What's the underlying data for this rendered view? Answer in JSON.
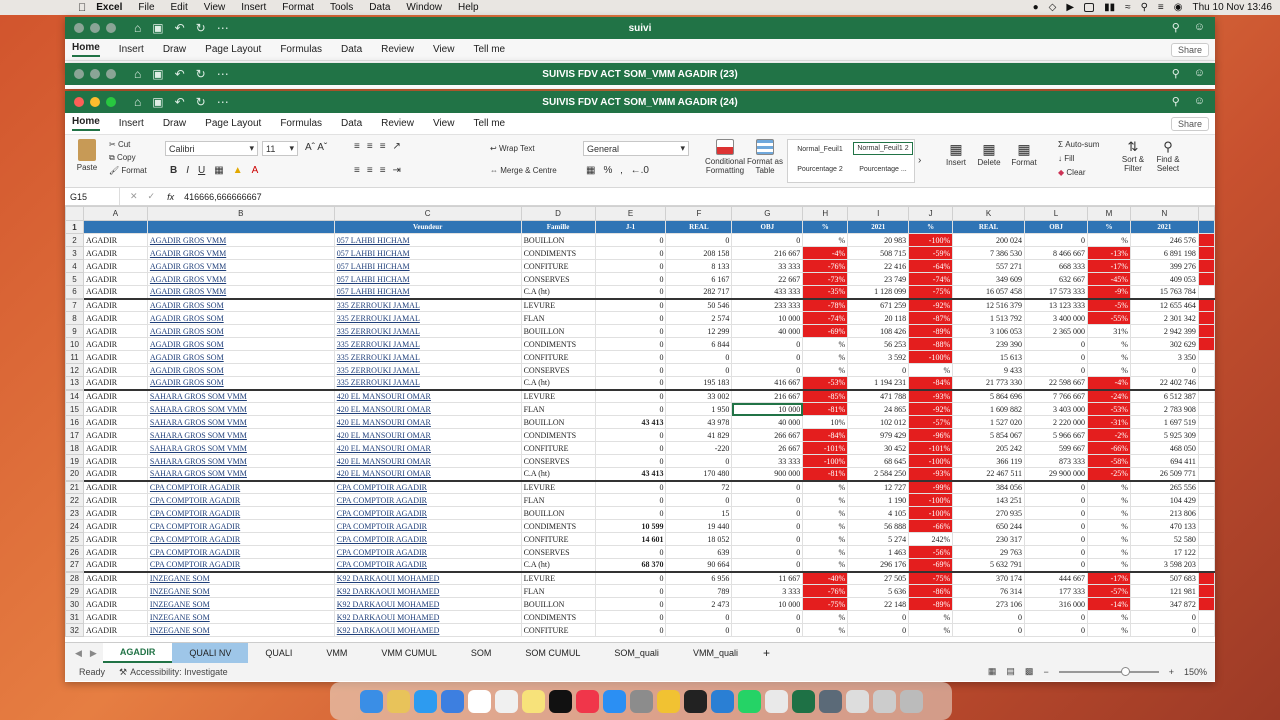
{
  "menubar": {
    "app": "Excel",
    "items": [
      "File",
      "Edit",
      "View",
      "Insert",
      "Format",
      "Tools",
      "Data",
      "Window",
      "Help"
    ],
    "datetime": "Thu 10 Nov  13:46"
  },
  "windows": {
    "w1_title": "suivi",
    "w2_title": "SUIVIS FDV ACT SOM_VMM AGADIR (23)",
    "w3_title": "SUIVIS FDV ACT SOM_VMM AGADIR (24)"
  },
  "ribbon_tabs": [
    "Home",
    "Insert",
    "Draw",
    "Page Layout",
    "Formulas",
    "Data",
    "Review",
    "View",
    "Tell me"
  ],
  "share": "Share",
  "ribbon": {
    "paste": "Paste",
    "cut": "Cut",
    "copy": "Copy",
    "format": "Format",
    "font": "Calibri",
    "size": "11",
    "wrap": "Wrap Text",
    "merge": "Merge & Centre",
    "numfmt": "General",
    "cond": "Conditional Formatting",
    "fmt_table": "Format as Table",
    "style1": "Normal_Feuil1",
    "style2": "Normal_Feuil1 2",
    "style3": "Pourcentage 2",
    "style4": "Pourcentage ...",
    "insert": "Insert",
    "delete": "Delete",
    "format2": "Format",
    "autosum": "Auto-sum",
    "fill": "Fill",
    "clear": "Clear",
    "sort": "Sort & Filter",
    "find": "Find & Select"
  },
  "formula": {
    "cell": "G15",
    "fx": "fx",
    "value": "416666,666666667"
  },
  "columns": [
    "A",
    "B",
    "C",
    "D",
    "E",
    "F",
    "G",
    "H",
    "I",
    "J",
    "K",
    "L",
    "M",
    "N"
  ],
  "header_row": [
    "",
    "",
    "Veundeur",
    "Famille",
    "J-1",
    "REAL",
    "OBJ",
    "%",
    "2021",
    "%",
    "REAL",
    "OBJ",
    "%",
    "2021"
  ],
  "rows": [
    [
      "2",
      "AGADIR",
      "AGADIR GROS VMM",
      "057 LAHBI HICHAM",
      "BOUILLON",
      "0",
      "0",
      "0",
      "%",
      "20 983",
      "-100%",
      "200 024",
      "0",
      "%",
      "246 576"
    ],
    [
      "3",
      "AGADIR",
      "AGADIR GROS VMM",
      "057 LAHBI HICHAM",
      "CONDIMENTS",
      "0",
      "208 158",
      "216 667",
      "-4%",
      "508 715",
      "-59%",
      "7 386 530",
      "8 466 667",
      "-13%",
      "6 891 198"
    ],
    [
      "4",
      "AGADIR",
      "AGADIR GROS VMM",
      "057 LAHBI HICHAM",
      "CONFITURE",
      "0",
      "8 133",
      "33 333",
      "-76%",
      "22 416",
      "-64%",
      "557 271",
      "668 333",
      "-17%",
      "399 276"
    ],
    [
      "5",
      "AGADIR",
      "AGADIR GROS VMM",
      "057 LAHBI HICHAM",
      "CONSERVES",
      "0",
      "6 167",
      "22 667",
      "-73%",
      "23 749",
      "-74%",
      "349 609",
      "632 667",
      "-45%",
      "409 053"
    ],
    [
      "6",
      "AGADIR",
      "AGADIR GROS VMM",
      "057 LAHBI HICHAM",
      "C.A (ht)",
      "0",
      "282 717",
      "433 333",
      "-35%",
      "1 128 099",
      "-75%",
      "16 057 458",
      "17 573 333",
      "-9%",
      "15 763 784"
    ],
    [
      "7",
      "AGADIR",
      "AGADIR GROS SOM",
      "335 ZERROUKI JAMAL",
      "LEVURE",
      "0",
      "50 546",
      "233 333",
      "-78%",
      "671 259",
      "-92%",
      "12 516 379",
      "13 123 333",
      "-5%",
      "12 655 464"
    ],
    [
      "8",
      "AGADIR",
      "AGADIR GROS SOM",
      "335 ZERROUKI JAMAL",
      "FLAN",
      "0",
      "2 574",
      "10 000",
      "-74%",
      "20 118",
      "-87%",
      "1 513 792",
      "3 400 000",
      "-55%",
      "2 301 342"
    ],
    [
      "9",
      "AGADIR",
      "AGADIR GROS SOM",
      "335 ZERROUKI JAMAL",
      "BOUILLON",
      "0",
      "12 299",
      "40 000",
      "-69%",
      "108 426",
      "-89%",
      "3 106 053",
      "2 365 000",
      "31%",
      "2 942 399"
    ],
    [
      "10",
      "AGADIR",
      "AGADIR GROS SOM",
      "335 ZERROUKI JAMAL",
      "CONDIMENTS",
      "0",
      "6 844",
      "0",
      "%",
      "56 253",
      "-88%",
      "239 390",
      "0",
      "%",
      "302 629"
    ],
    [
      "11",
      "AGADIR",
      "AGADIR GROS SOM",
      "335 ZERROUKI JAMAL",
      "CONFITURE",
      "0",
      "0",
      "0",
      "%",
      "3 592",
      "-100%",
      "15 613",
      "0",
      "%",
      "3 350"
    ],
    [
      "12",
      "AGADIR",
      "AGADIR GROS SOM",
      "335 ZERROUKI JAMAL",
      "CONSERVES",
      "0",
      "0",
      "0",
      "%",
      "0",
      "%",
      "9 433",
      "0",
      "%",
      "0"
    ],
    [
      "13",
      "AGADIR",
      "AGADIR GROS SOM",
      "335 ZERROUKI JAMAL",
      "C.A (ht)",
      "0",
      "195 183",
      "416 667",
      "-53%",
      "1 194 231",
      "-84%",
      "21 773 330",
      "22 598 667",
      "-4%",
      "22 402 746"
    ],
    [
      "14",
      "AGADIR",
      "SAHARA GROS SOM VMM",
      "420 EL MANSOURI OMAR",
      "LEVURE",
      "0",
      "33 002",
      "216 667",
      "-85%",
      "471 788",
      "-93%",
      "5 864 696",
      "7 766 667",
      "-24%",
      "6 512 387"
    ],
    [
      "15",
      "AGADIR",
      "SAHARA GROS SOM VMM",
      "420 EL MANSOURI OMAR",
      "FLAN",
      "0",
      "1 950",
      "10 000",
      "-81%",
      "24 865",
      "-92%",
      "1 609 882",
      "3 403 000",
      "-53%",
      "2 783 908"
    ],
    [
      "16",
      "AGADIR",
      "SAHARA GROS SOM VMM",
      "420 EL MANSOURI OMAR",
      "BOUILLON",
      "43 413",
      "43 978",
      "40 000",
      "10%",
      "102 012",
      "-57%",
      "1 527 020",
      "2 220 000",
      "-31%",
      "1 697 519"
    ],
    [
      "17",
      "AGADIR",
      "SAHARA GROS SOM VMM",
      "420 EL MANSOURI OMAR",
      "CONDIMENTS",
      "0",
      "41 829",
      "266 667",
      "-84%",
      "979 429",
      "-96%",
      "5 854 067",
      "5 966 667",
      "-2%",
      "5 925 309"
    ],
    [
      "18",
      "AGADIR",
      "SAHARA GROS SOM VMM",
      "420 EL MANSOURI OMAR",
      "CONFITURE",
      "0",
      "-220",
      "26 667",
      "-101%",
      "30 452",
      "-101%",
      "205 242",
      "599 667",
      "-66%",
      "468 050"
    ],
    [
      "19",
      "AGADIR",
      "SAHARA GROS SOM VMM",
      "420 EL MANSOURI OMAR",
      "CONSERVES",
      "0",
      "0",
      "33 333",
      "-100%",
      "68 645",
      "-100%",
      "366 119",
      "873 333",
      "-58%",
      "694 411"
    ],
    [
      "20",
      "AGADIR",
      "SAHARA GROS SOM VMM",
      "420 EL MANSOURI OMAR",
      "C.A (ht)",
      "43 413",
      "170 480",
      "900 000",
      "-81%",
      "2 584 250",
      "-93%",
      "22 467 511",
      "29 900 000",
      "-25%",
      "26 509 771"
    ],
    [
      "21",
      "AGADIR",
      "CPA COMPTOIR AGADIR",
      "CPA COMPTOIR AGADIR",
      "LEVURE",
      "0",
      "72",
      "0",
      "%",
      "12 727",
      "-99%",
      "384 056",
      "0",
      "%",
      "265 556"
    ],
    [
      "22",
      "AGADIR",
      "CPA COMPTOIR AGADIR",
      "CPA COMPTOIR AGADIR",
      "FLAN",
      "0",
      "0",
      "0",
      "%",
      "1 190",
      "-100%",
      "143 251",
      "0",
      "%",
      "104 429"
    ],
    [
      "23",
      "AGADIR",
      "CPA COMPTOIR AGADIR",
      "CPA COMPTOIR AGADIR",
      "BOUILLON",
      "0",
      "15",
      "0",
      "%",
      "4 105",
      "-100%",
      "270 935",
      "0",
      "%",
      "213 806"
    ],
    [
      "24",
      "AGADIR",
      "CPA COMPTOIR AGADIR",
      "CPA COMPTOIR AGADIR",
      "CONDIMENTS",
      "10 599",
      "19 440",
      "0",
      "%",
      "56 888",
      "-66%",
      "650 244",
      "0",
      "%",
      "470 133"
    ],
    [
      "25",
      "AGADIR",
      "CPA COMPTOIR AGADIR",
      "CPA COMPTOIR AGADIR",
      "CONFITURE",
      "14 601",
      "18 052",
      "0",
      "%",
      "5 274",
      "242%",
      "230 317",
      "0",
      "%",
      "52 580"
    ],
    [
      "26",
      "AGADIR",
      "CPA COMPTOIR AGADIR",
      "CPA COMPTOIR AGADIR",
      "CONSERVES",
      "0",
      "639",
      "0",
      "%",
      "1 463",
      "-56%",
      "29 763",
      "0",
      "%",
      "17 122"
    ],
    [
      "27",
      "AGADIR",
      "CPA COMPTOIR AGADIR",
      "CPA COMPTOIR AGADIR",
      "C.A (ht)",
      "68 370",
      "90 664",
      "0",
      "%",
      "296 176",
      "-69%",
      "5 632 791",
      "0",
      "%",
      "3 598 203"
    ],
    [
      "28",
      "AGADIR",
      "INZEGANE SOM",
      "K92 DARKAOUI MOHAMED",
      "LEVURE",
      "0",
      "6 956",
      "11 667",
      "-40%",
      "27 505",
      "-75%",
      "370 174",
      "444 667",
      "-17%",
      "507 683"
    ],
    [
      "29",
      "AGADIR",
      "INZEGANE SOM",
      "K92 DARKAOUI MOHAMED",
      "FLAN",
      "0",
      "789",
      "3 333",
      "-76%",
      "5 636",
      "-86%",
      "76 314",
      "177 333",
      "-57%",
      "121 981"
    ],
    [
      "30",
      "AGADIR",
      "INZEGANE SOM",
      "K92 DARKAOUI MOHAMED",
      "BOUILLON",
      "0",
      "2 473",
      "10 000",
      "-75%",
      "22 148",
      "-89%",
      "273 106",
      "316 000",
      "-14%",
      "347 872"
    ],
    [
      "31",
      "AGADIR",
      "INZEGANE SOM",
      "K92 DARKAOUI MOHAMED",
      "CONDIMENTS",
      "0",
      "0",
      "0",
      "%",
      "0",
      "%",
      "0",
      "0",
      "%",
      "0"
    ],
    [
      "32",
      "AGADIR",
      "INZEGANE SOM",
      "K92 DARKAOUI MOHAMED",
      "CONFITURE",
      "0",
      "0",
      "0",
      "%",
      "0",
      "%",
      "0",
      "0",
      "%",
      "0"
    ]
  ],
  "sheet_tabs": [
    "AGADIR",
    "QUALI NV",
    "QUALI",
    "VMM",
    "VMM CUMUL",
    "SOM",
    "SOM CUMUL",
    "SOM_quali",
    "VMM_quali"
  ],
  "status": {
    "ready": "Ready",
    "access": "Accessibility: Investigate",
    "zoom": "150%"
  },
  "colors": {
    "excel_green": "#217346",
    "header_blue": "#2f74b5",
    "neg_red": "#e41e1e"
  }
}
